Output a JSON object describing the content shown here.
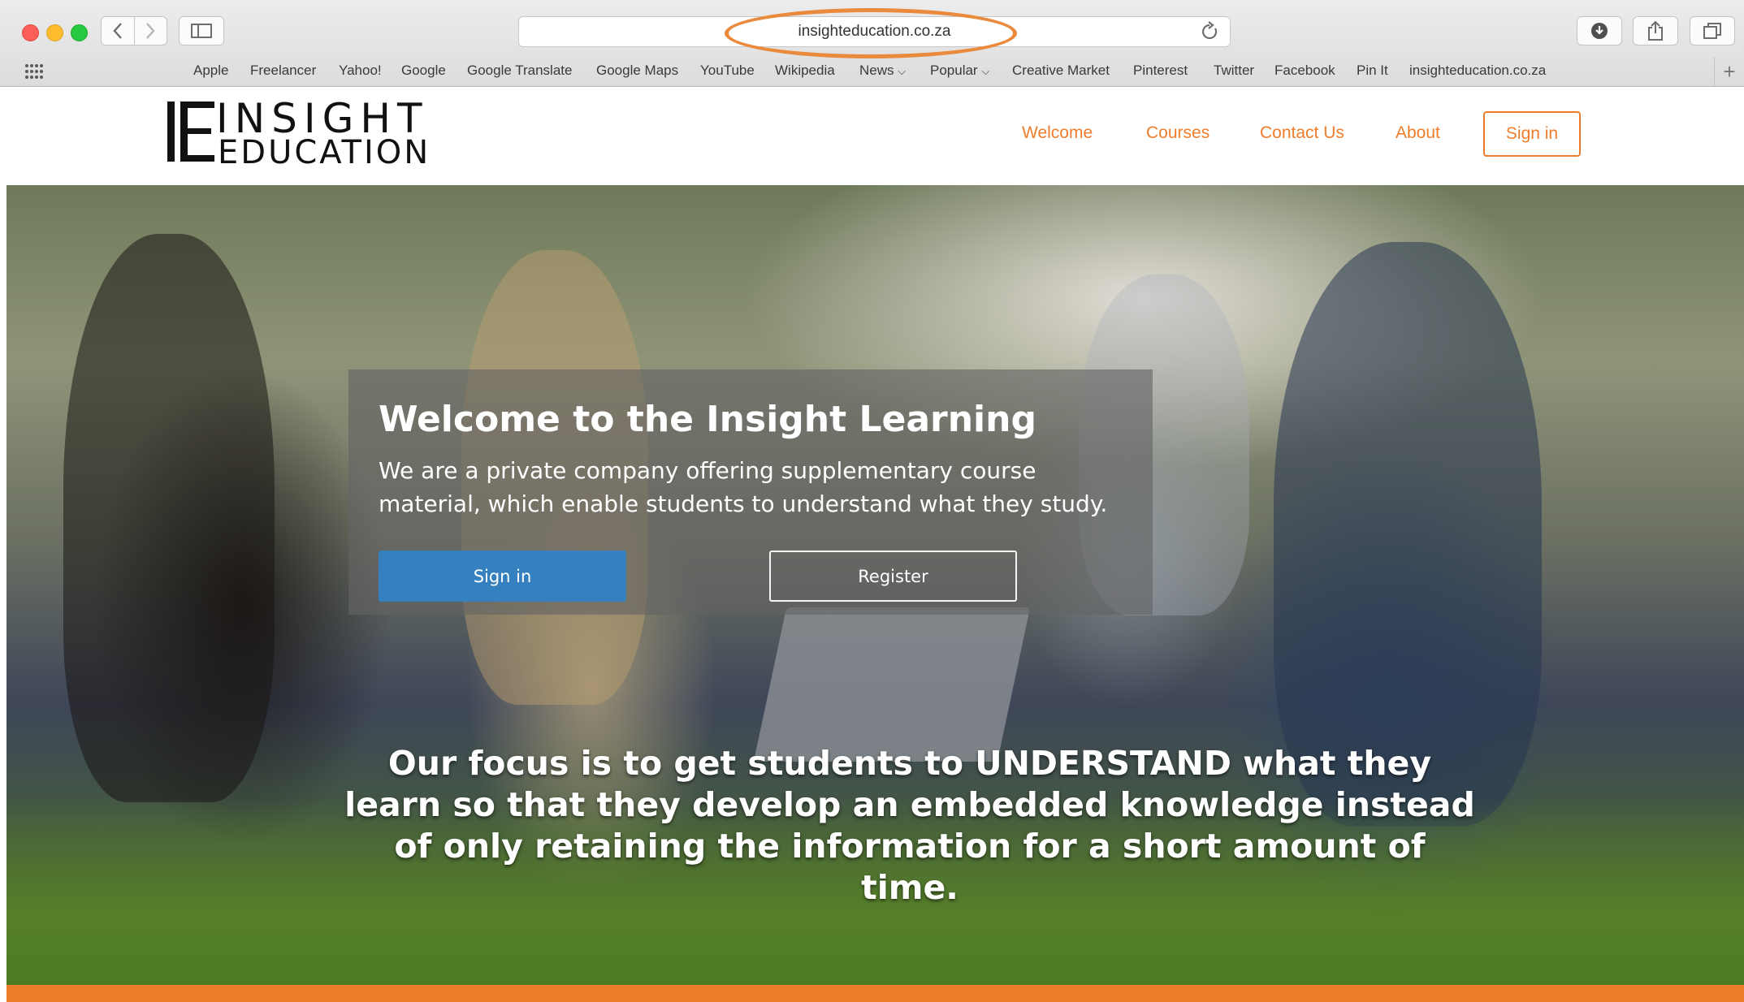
{
  "browser": {
    "url": "insighteducation.co.za",
    "bookmarks": [
      "Apple",
      "Freelancer",
      "Yahoo!",
      "Google",
      "Google Translate",
      "Google Maps",
      "YouTube",
      "Wikipedia",
      "News",
      "Popular",
      "Creative Market",
      "Pinterest",
      "Twitter",
      "Facebook",
      "Pin It",
      "insighteducation.co.za"
    ],
    "highlight_color": "#ea8a3c"
  },
  "header": {
    "logo_insight": "INSIGHT",
    "logo_education": "EDUCATION",
    "nav": [
      "Welcome",
      "Courses",
      "Contact Us",
      "About"
    ],
    "signin_label": "Sign in",
    "accent_color": "#ee7d2b"
  },
  "hero": {
    "title": "Welcome to the Insight Learning",
    "subtitle": "We are a private company offering supplementary course material, which enable students to understand what they study.",
    "signin_button": "Sign in",
    "register_button": "Register",
    "focus_text": "Our focus is to get students to UNDERSTAND what they learn so that they develop an embedded knowledge instead of only retaining the information for a short amount of time.",
    "button_color": "#3580bf"
  }
}
